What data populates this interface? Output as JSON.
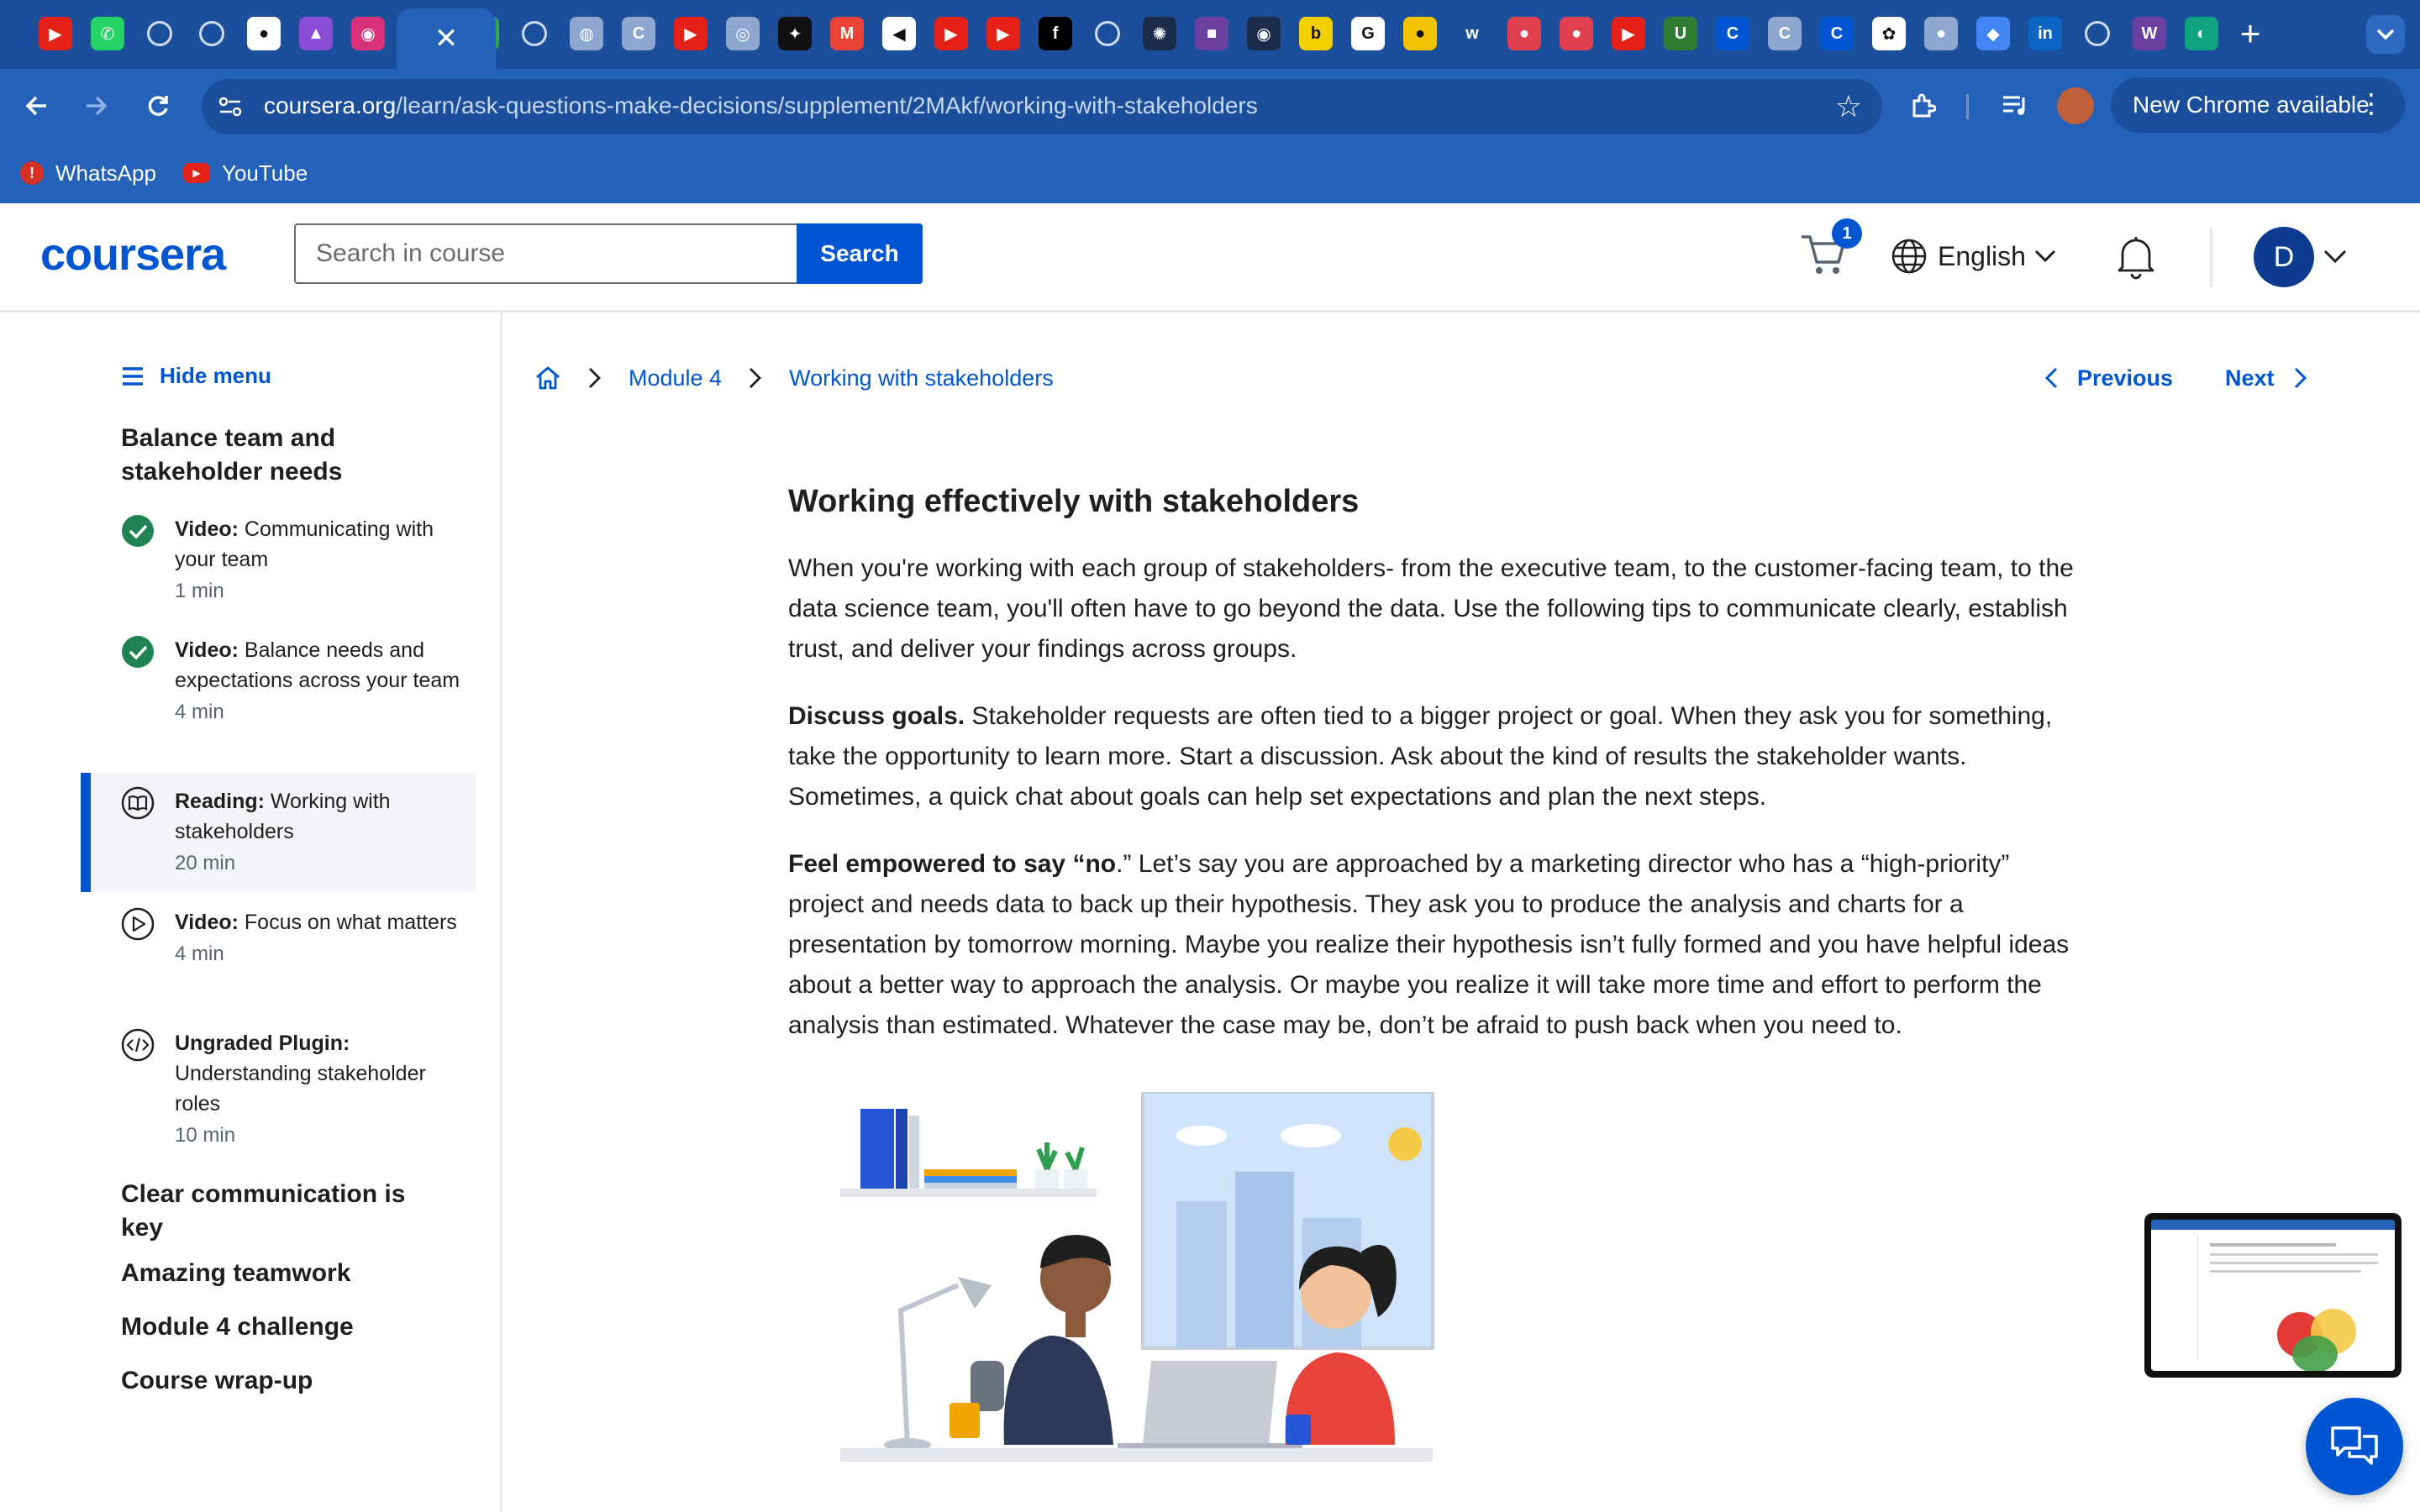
{
  "browser": {
    "active_tab_close": "✕",
    "url_host": "coursera.org",
    "url_path": "/learn/ask-questions-make-decisions/supplement/2MAkf/working-with-stakeholders",
    "update_label": "New Chrome available",
    "bookmarks": [
      {
        "label": "WhatsApp",
        "icon": "whatsapp-icon"
      },
      {
        "label": "YouTube",
        "icon": "youtube-icon"
      }
    ],
    "tab_favicons": [
      {
        "icon": "youtube-icon",
        "color": "#e62117",
        "glyph": "▶"
      },
      {
        "icon": "whatsapp-icon",
        "color": "#25d366",
        "glyph": "✆"
      },
      {
        "icon": "loading-icon",
        "color": "",
        "glyph": ""
      },
      {
        "icon": "loading-icon",
        "color": "",
        "glyph": ""
      },
      {
        "icon": "github-icon",
        "color": "#ffffff",
        "glyph": "●"
      },
      {
        "icon": "app-icon",
        "color": "#8a4dd8",
        "glyph": "▲"
      },
      {
        "icon": "app-icon",
        "color": "#d8317a",
        "glyph": "◉"
      },
      {
        "icon": "app-icon",
        "color": "#34a853",
        "glyph": "+"
      },
      {
        "icon": "loading-icon",
        "color": "",
        "glyph": ""
      },
      {
        "icon": "globe-icon",
        "color": "#8fa7d0",
        "glyph": "◍"
      },
      {
        "icon": "coursera-icon",
        "color": "#8fa7d0",
        "glyph": "C"
      },
      {
        "icon": "youtube-icon",
        "color": "#e62117",
        "glyph": "▶"
      },
      {
        "icon": "app-icon",
        "color": "#8fa7d0",
        "glyph": "◎"
      },
      {
        "icon": "app-icon",
        "color": "#111111",
        "glyph": "✦"
      },
      {
        "icon": "gmail-icon",
        "color": "#ea4335",
        "glyph": "M"
      },
      {
        "icon": "speaker-icon",
        "color": "#ffffff",
        "glyph": "◀"
      },
      {
        "icon": "youtube-icon",
        "color": "#e62117",
        "glyph": "▶"
      },
      {
        "icon": "youtube-icon",
        "color": "#e62117",
        "glyph": "▶"
      },
      {
        "icon": "app-icon",
        "color": "#000000",
        "glyph": "f"
      },
      {
        "icon": "loading-icon",
        "color": "",
        "glyph": ""
      },
      {
        "icon": "app-icon",
        "color": "#1b2b4a",
        "glyph": "✺"
      },
      {
        "icon": "app-icon",
        "color": "#6b3fa0",
        "glyph": "■"
      },
      {
        "icon": "app-icon",
        "color": "#1b2b4a",
        "glyph": "◉"
      },
      {
        "icon": "app-icon",
        "color": "#f5d000",
        "glyph": "b"
      },
      {
        "icon": "google-icon",
        "color": "#ffffff",
        "glyph": "G"
      },
      {
        "icon": "app-icon",
        "color": "#f5c400",
        "glyph": "●"
      },
      {
        "icon": "app-icon",
        "color": "#1b4e9b",
        "glyph": "w"
      },
      {
        "icon": "app-icon",
        "color": "#e04050",
        "glyph": "●"
      },
      {
        "icon": "app-icon",
        "color": "#e04050",
        "glyph": "●"
      },
      {
        "icon": "youtube-icon",
        "color": "#e62117",
        "glyph": "▶"
      },
      {
        "icon": "app-icon",
        "color": "#2e7d32",
        "glyph": "U"
      },
      {
        "icon": "coursera-icon",
        "color": "#0056d2",
        "glyph": "C"
      },
      {
        "icon": "coursera-icon",
        "color": "#8fa7d0",
        "glyph": "C"
      },
      {
        "icon": "coursera-icon",
        "color": "#0056d2",
        "glyph": "C"
      },
      {
        "icon": "chatgpt-icon",
        "color": "#ffffff",
        "glyph": "✿"
      },
      {
        "icon": "github-icon",
        "color": "#8fa7d0",
        "glyph": "●"
      },
      {
        "icon": "maps-icon",
        "color": "#4285f4",
        "glyph": "◆"
      },
      {
        "icon": "linkedin-icon",
        "color": "#0a66c2",
        "glyph": "in"
      },
      {
        "icon": "loading-icon",
        "color": "",
        "glyph": ""
      },
      {
        "icon": "app-icon",
        "color": "#6b3fa0",
        "glyph": "W"
      },
      {
        "icon": "app-icon",
        "color": "#10a37f",
        "glyph": "◐"
      }
    ]
  },
  "header": {
    "logo": "coursera",
    "search_placeholder": "Search in course",
    "search_button": "Search",
    "cart_count": "1",
    "language": "English",
    "user_initial": "D"
  },
  "sidebar": {
    "hide_menu": "Hide menu",
    "section_title": "Balance team and stakeholder needs",
    "lessons": [
      {
        "type": "Video:",
        "title": "Communicating with your team",
        "duration": "1 min",
        "status": "completed"
      },
      {
        "type": "Video:",
        "title": "Balance needs and expectations across your team",
        "duration": "4 min",
        "status": "completed"
      },
      {
        "type": "Reading:",
        "title": "Working with stakeholders",
        "duration": "20 min",
        "status": "current"
      },
      {
        "type": "Video:",
        "title": "Focus on what matters",
        "duration": "4 min",
        "status": "not-started"
      },
      {
        "type": "Ungraded Plugin:",
        "title": "Understanding stakeholder roles",
        "duration": "10 min",
        "status": "not-started"
      }
    ],
    "modules": [
      "Clear communication is key",
      "Amazing teamwork",
      "Module 4 challenge",
      "Course wrap-up"
    ]
  },
  "breadcrumb": {
    "module": "Module 4",
    "page": "Working with stakeholders"
  },
  "pager": {
    "previous": "Previous",
    "next": "Next"
  },
  "article": {
    "heading": "Working effectively with stakeholders",
    "intro": "When you're working with each group of stakeholders- from the executive team, to the customer-facing team, to the data science team, you'll often have to go beyond the data. Use the following tips to communicate clearly, establish trust, and deliver your findings across groups.",
    "p1_bold": "Discuss goals.",
    "p1_text": " Stakeholder requests are often tied to a bigger project or goal. When they ask you for something, take the opportunity to learn more. Start a discussion. Ask about the kind of results the stakeholder wants. Sometimes, a quick chat about goals can help set expectations and plan the next steps.",
    "p2_bold": "Feel empowered to say “no",
    "p2_text": ".” Let’s say you are approached by a marketing director who has a “high-priority” project and needs data to back up their hypothesis. They ask you to produce the analysis and charts for a presentation by tomorrow morning. Maybe you realize their hypothesis isn’t fully formed and you have helpful ideas about a better way to approach the analysis. Or maybe you realize it will take more time and effort to perform the analysis than estimated. Whatever the case may be, don’t be afraid to push back when you need to."
  },
  "colors": {
    "brand": "#0056d2",
    "chrome_dark": "#1b4e9b",
    "chrome_mid": "#2461b8",
    "completed": "#1f8354"
  }
}
